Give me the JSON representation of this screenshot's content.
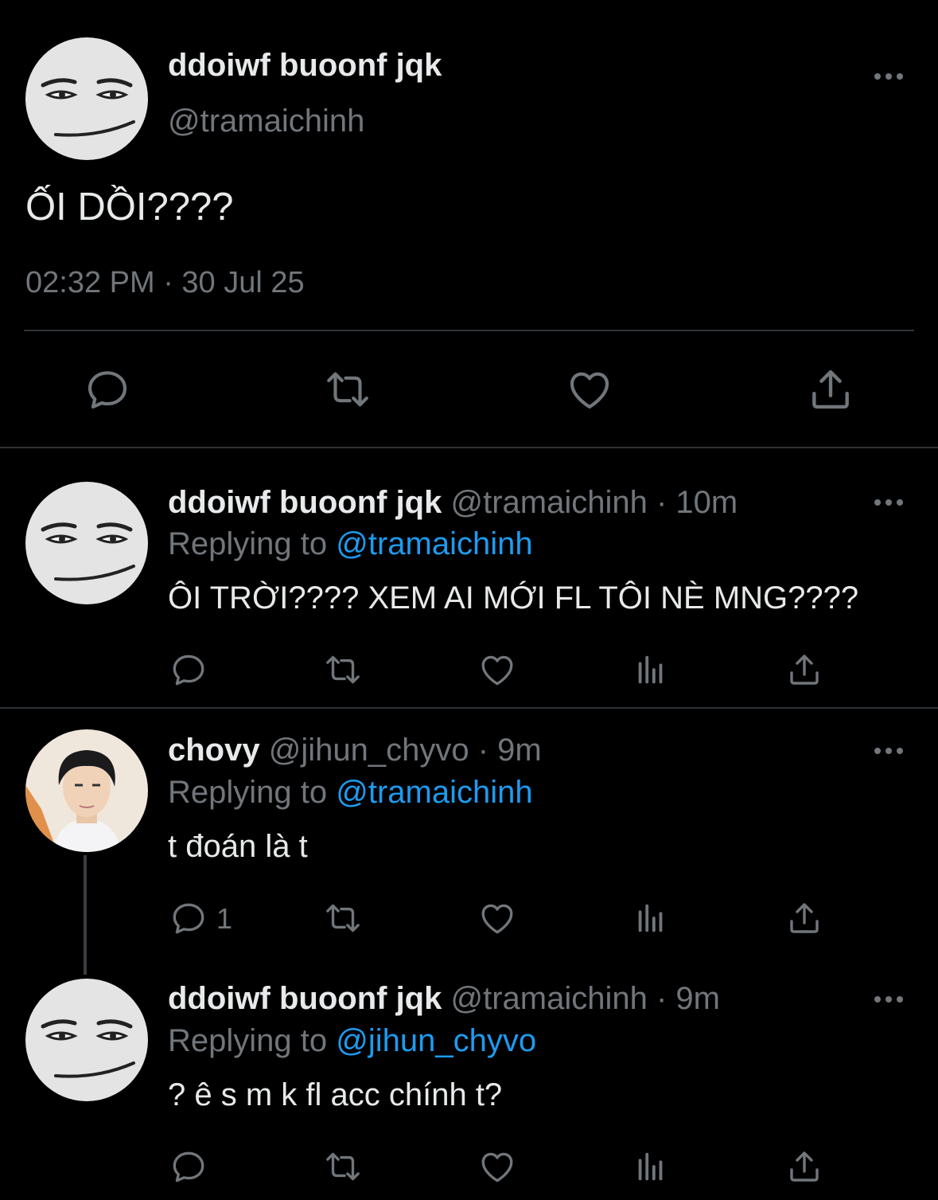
{
  "main_tweet": {
    "display_name": "ddoiwf buoonf jqk",
    "handle": "@tramaichinh",
    "text": "ỐI DỒI????",
    "timestamp": "02:32 PM · 30 Jul 25"
  },
  "replies": [
    {
      "display_name": "ddoiwf buoonf jqk",
      "handle": "@tramaichinh",
      "time": "· 10m",
      "replying_label": "Replying to",
      "replying_to": "@tramaichinh",
      "text": "ÔI TRỜI???? XEM AI MỚI FL TÔI NÈ MNG????",
      "reply_count": ""
    },
    {
      "display_name": "chovy",
      "handle": "@jihun_chyvo",
      "time": "· 9m",
      "replying_label": "Replying to",
      "replying_to": "@tramaichinh",
      "text": "t đoán là t",
      "reply_count": "1"
    },
    {
      "display_name": "ddoiwf buoonf jqk",
      "handle": "@tramaichinh",
      "time": "· 9m",
      "replying_label": "Replying to",
      "replying_to": "@jihun_chyvo",
      "text": "? ê s m k fl acc chính t?",
      "reply_count": ""
    }
  ],
  "colors": {
    "background": "#000000",
    "text": "#e7e9ea",
    "muted": "#71767b",
    "link": "#1d9bf0",
    "divider": "#2f3336"
  }
}
